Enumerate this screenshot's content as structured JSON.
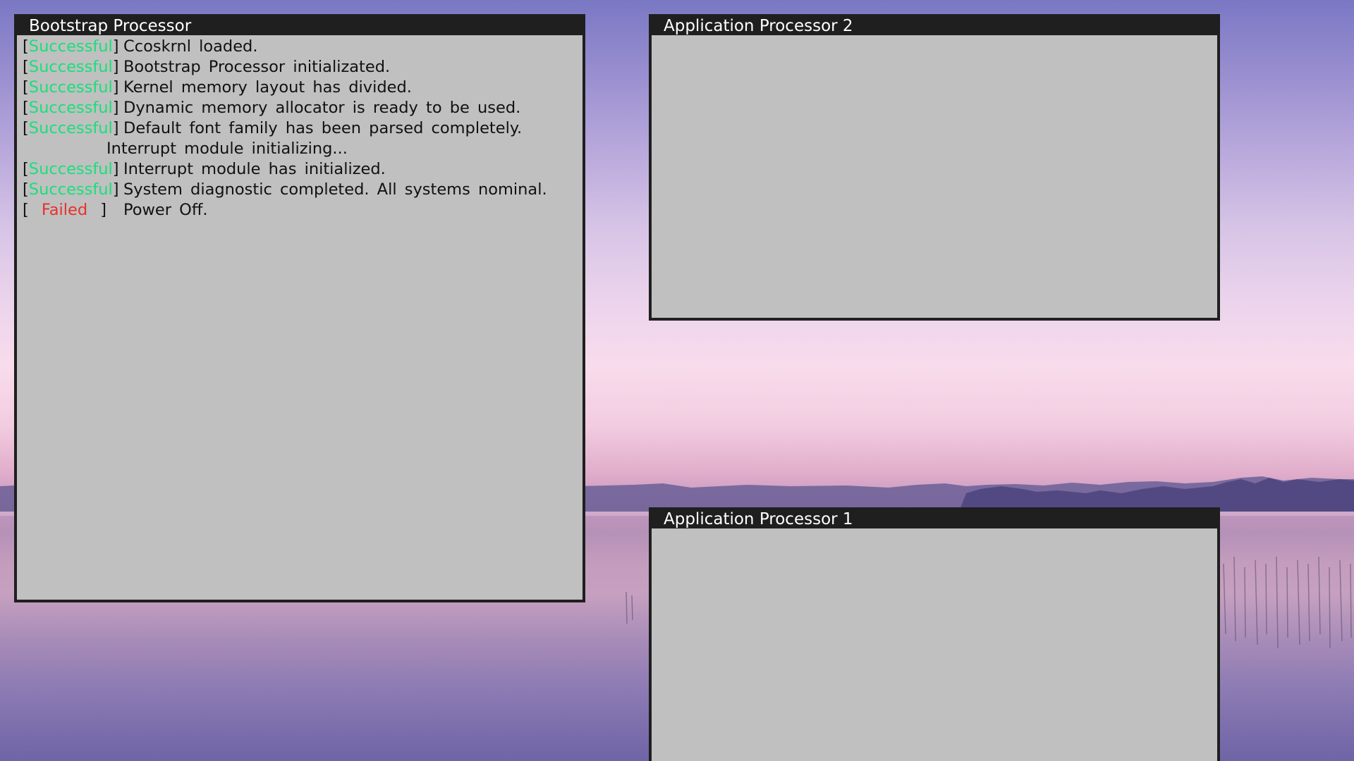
{
  "colors": {
    "titlebar": "#1f1f1f",
    "window_bg": "#c0c0c0",
    "success": "#18e07a",
    "failed": "#e8302c"
  },
  "windows": {
    "bootstrap": {
      "title": "Bootstrap Processor",
      "log": [
        {
          "status": "Successful",
          "kind": "success",
          "message": "Ccoskrnl loaded."
        },
        {
          "status": "Successful",
          "kind": "success",
          "message": "Bootstrap Processor initializated."
        },
        {
          "status": "Successful",
          "kind": "success",
          "message": "Kernel memory layout has divided."
        },
        {
          "status": "Successful",
          "kind": "success",
          "message": "Dynamic memory allocator is ready to be used."
        },
        {
          "status": "Successful",
          "kind": "success",
          "message": "Default font family has been parsed completely."
        },
        {
          "status": "",
          "kind": "plain",
          "message": "Interrupt module initializing..."
        },
        {
          "status": "Successful",
          "kind": "success",
          "message": "Interrupt module has initialized."
        },
        {
          "status": "Successful",
          "kind": "success",
          "message": "System diagnostic completed. All systems nominal."
        },
        {
          "status": "Failed",
          "kind": "failed",
          "message": "Power Off."
        }
      ]
    },
    "ap2": {
      "title": "Application Processor 2"
    },
    "ap1": {
      "title": "Application Processor 1"
    }
  }
}
